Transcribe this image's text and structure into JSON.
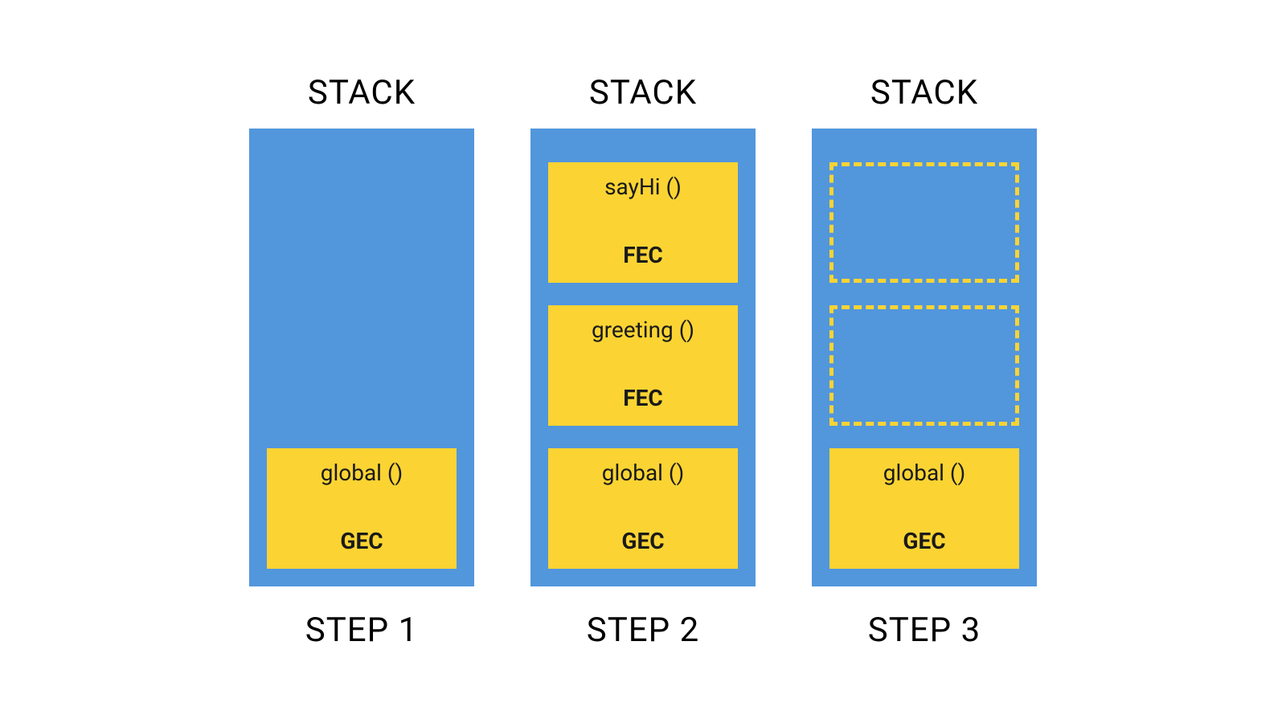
{
  "columns": [
    {
      "title": "STACK",
      "step": "STEP 1",
      "frames": [
        {
          "type": "solid",
          "name": "global ()",
          "label": "GEC"
        }
      ]
    },
    {
      "title": "STACK",
      "step": "STEP 2",
      "frames": [
        {
          "type": "solid",
          "name": "sayHi ()",
          "label": "FEC"
        },
        {
          "type": "solid",
          "name": "greeting ()",
          "label": "FEC"
        },
        {
          "type": "solid",
          "name": "global ()",
          "label": "GEC"
        }
      ]
    },
    {
      "title": "STACK",
      "step": "STEP 3",
      "frames": [
        {
          "type": "empty"
        },
        {
          "type": "empty"
        },
        {
          "type": "solid",
          "name": "global ()",
          "label": "GEC"
        }
      ]
    }
  ]
}
